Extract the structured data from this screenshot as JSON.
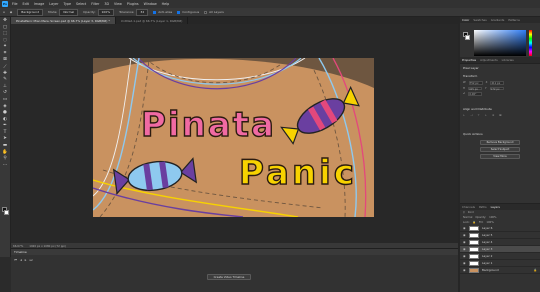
{
  "app": {
    "logo": "Ps"
  },
  "menu": [
    "File",
    "Edit",
    "Image",
    "Layer",
    "Type",
    "Select",
    "Filter",
    "3D",
    "View",
    "Plugins",
    "Window",
    "Help"
  ],
  "options": {
    "tool_preset": "Background",
    "mode_label": "Mode:",
    "mode_value": "Normal",
    "opacity_label": "Opacity:",
    "opacity_value": "100%",
    "tolerance_label": "Tolerance:",
    "tolerance_value": "32",
    "antialias_label": "Anti-alias",
    "contiguous_label": "Contiguous",
    "all_layers_label": "All Layers"
  },
  "doc_tabs": [
    {
      "label": "PinataPanic Mian Menu Screen.psd @ 66.7% (Layer 3, RGB/8#) *",
      "active": true
    },
    {
      "label": "Untitled-1.psd @ 66.7% (Layer 1, RGB/8#)",
      "active": false
    }
  ],
  "artwork": {
    "title_line1": "Pinata",
    "title_line2": "Panic"
  },
  "status": {
    "zoom": "66.67%",
    "doc_size": "1920 px x 1080 px (72 ppi)"
  },
  "timeline": {
    "title": "Timeline",
    "create_button": "Create Video Timeline"
  },
  "color_panel": {
    "tabs": [
      "Color",
      "Swatches",
      "Gradients",
      "Patterns"
    ]
  },
  "properties_panel": {
    "tabs": [
      "Properties",
      "Adjustments",
      "Libraries"
    ],
    "layer_type": "Pixel Layer",
    "transform_title": "Transform",
    "w_label": "W",
    "w_value": "752 px",
    "h_label": "H",
    "h_value": "415 px",
    "x_label": "X",
    "x_value": "411 px",
    "y_label": "Y",
    "y_value": "172 px",
    "angle_value": "0.00°",
    "align_title": "Align and Distribute",
    "quick_actions_title": "Quick Actions",
    "remove_bg_button": "Remove Background",
    "select_subject_button": "Select Subject",
    "more_button": "View More"
  },
  "layers_panel": {
    "tabs": [
      "Channels",
      "Paths",
      "Layers"
    ],
    "kind_label": "Kind",
    "blend_mode": "Normal",
    "opacity_label": "Opacity:",
    "opacity_value": "100%",
    "lock_label": "Lock:",
    "fill_label": "Fill:",
    "fill_value": "100%",
    "layers": [
      {
        "name": "Layer 6",
        "selected": false
      },
      {
        "name": "Layer 5",
        "selected": false
      },
      {
        "name": "Layer 4",
        "selected": false
      },
      {
        "name": "Layer 3",
        "selected": true
      },
      {
        "name": "Layer 2",
        "selected": false
      },
      {
        "name": "Layer 1",
        "selected": false
      },
      {
        "name": "Background",
        "selected": false
      }
    ]
  },
  "colors": {
    "accent": "#31a8ff",
    "tan": "#c99260",
    "brown": "#6e5640",
    "pink": "#f06aa3",
    "purple": "#6a3fa0",
    "yellow": "#f7d200",
    "blue": "#8ec9ef",
    "candy_pink": "#e3487c"
  }
}
